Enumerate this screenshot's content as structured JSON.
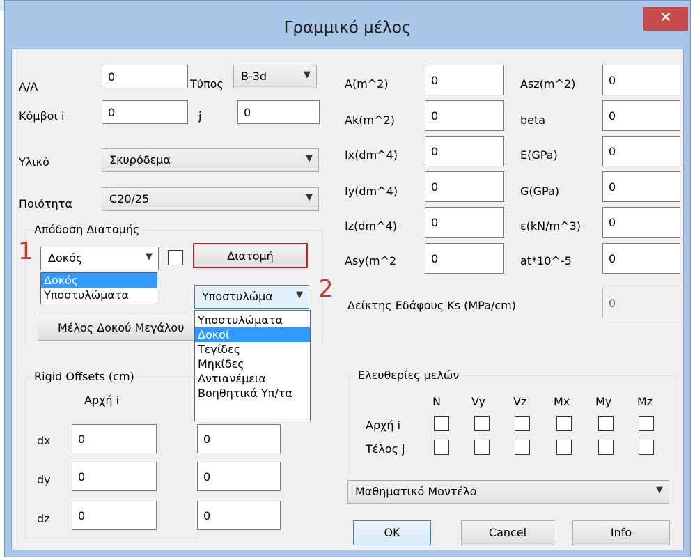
{
  "window": {
    "title": "Γραμμικό μέλος",
    "close_icon": "✕"
  },
  "left": {
    "aa_label": "A/A",
    "aa_value": "0",
    "type_label": "Τύπος",
    "type_value": "B-3d",
    "nodes_label": "Κόμβοι i",
    "node_i": "0",
    "j_label": "j",
    "node_j": "0",
    "material_label": "Υλικό",
    "material_value": "Σκυρόδεμα",
    "quality_label": "Ποιότητα",
    "quality_value": "C20/25"
  },
  "section_group": {
    "legend": "Απόδοση Διατομής",
    "role_value": "Δοκός",
    "role_options": [
      "Δοκός",
      "Υποστυλώματα"
    ],
    "section_button": "Διατομή",
    "category_value": "Υποστυλώμα",
    "category_options": [
      "Υποστυλώματα",
      "Δοκοί",
      "Τεγίδες",
      "Μηκίδες",
      "Αντιανέμεια",
      "Βοηθητικά Υπ/τα"
    ],
    "long_beam_button": "Μέλος Δοκού Μεγάλου"
  },
  "annotations": {
    "one": "1",
    "two": "2"
  },
  "rigid": {
    "legend": "Rigid Offsets (cm)",
    "start_label": "Αρχή i",
    "dx_label": "dx",
    "dy_label": "dy",
    "dz_label": "dz",
    "dx_i": "0",
    "dx_j": "0",
    "dy_i": "0",
    "dy_j": "0",
    "dz_i": "0",
    "dz_j": "0"
  },
  "props": {
    "A_label": "A(m^2)",
    "A": "0",
    "Ak_label": "Ak(m^2)",
    "Ak": "0",
    "Ix_label": "Ix(dm^4)",
    "Ix": "0",
    "Iy_label": "Iy(dm^4)",
    "Iy": "0",
    "Iz_label": "Iz(dm^4)",
    "Iz": "0",
    "Asy_label": "Asy(m^2",
    "Asy": "0",
    "Asz_label": "Asz(m^2)",
    "Asz": "0",
    "beta_label": "beta",
    "beta": "0",
    "E_label": "E(GPa)",
    "E": "0",
    "G_label": "G(GPa)",
    "G": "0",
    "eps_label": "ε(kN/m^3)",
    "eps": "0",
    "at_label": "at*10^-5",
    "at": "0",
    "ks_label": "Δείκτης Εδάφους Ks (MPa/cm)",
    "ks": "0"
  },
  "dof": {
    "legend": "Ελευθερίες μελών",
    "columns": [
      "N",
      "Vy",
      "Vz",
      "Mx",
      "My",
      "Mz"
    ],
    "start_label": "Αρχή i",
    "end_label": "Τέλος j"
  },
  "model": {
    "value": "Μαθηματικό Μοντέλο"
  },
  "buttons": {
    "ok": "OK",
    "cancel": "Cancel",
    "info": "Info"
  }
}
